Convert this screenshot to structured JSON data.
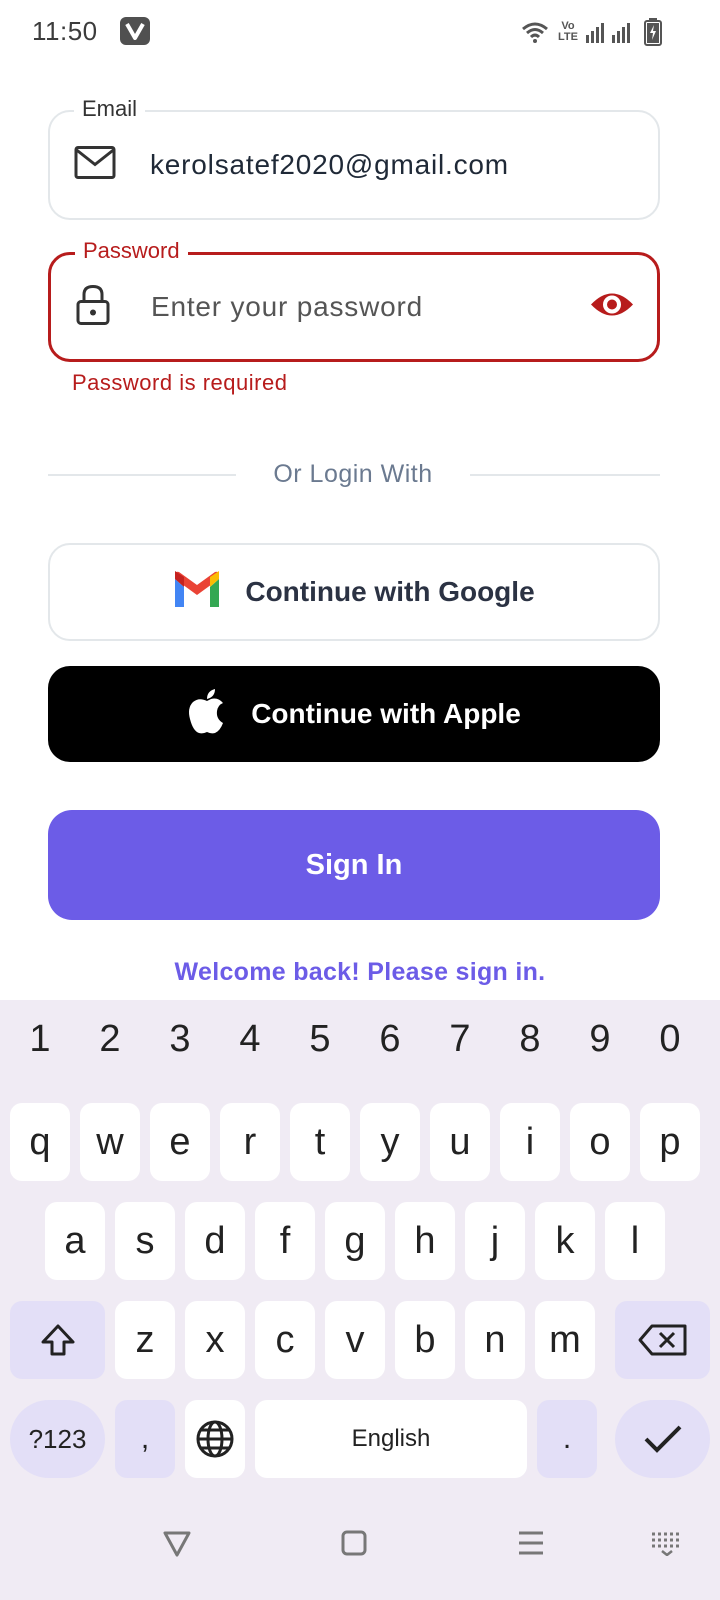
{
  "status_bar": {
    "time": "11:50",
    "app_badge": "V",
    "volte_top": "Vo",
    "volte_bottom": "LTE"
  },
  "form": {
    "email": {
      "label": "Email",
      "value": "kerolsatef2020@gmail.com",
      "icon": "mail-icon"
    },
    "password": {
      "label": "Password",
      "placeholder": "Enter your password",
      "icon": "lock-icon",
      "visibility_icon": "eye-icon",
      "error": "Password is required"
    },
    "divider_text": "Or Login With",
    "google_button": "Continue with Google",
    "apple_button": "Continue with Apple",
    "sign_in_button": "Sign In",
    "welcome": "Welcome back! Please sign in."
  },
  "keyboard": {
    "number_row": [
      "1",
      "2",
      "3",
      "4",
      "5",
      "6",
      "7",
      "8",
      "9",
      "0"
    ],
    "row1": [
      "q",
      "w",
      "e",
      "r",
      "t",
      "y",
      "u",
      "i",
      "o",
      "p"
    ],
    "row2": [
      "a",
      "s",
      "d",
      "f",
      "g",
      "h",
      "j",
      "k",
      "l"
    ],
    "row3": [
      "z",
      "x",
      "c",
      "v",
      "b",
      "n",
      "m"
    ],
    "symbols_key": "?123",
    "comma_key": ",",
    "space_label": "English",
    "period_key": "."
  },
  "colors": {
    "accent": "#6c5ce7",
    "error": "#b71c1c",
    "keyboard_bg": "#f0ebf4",
    "special_key": "#e3dff7"
  }
}
